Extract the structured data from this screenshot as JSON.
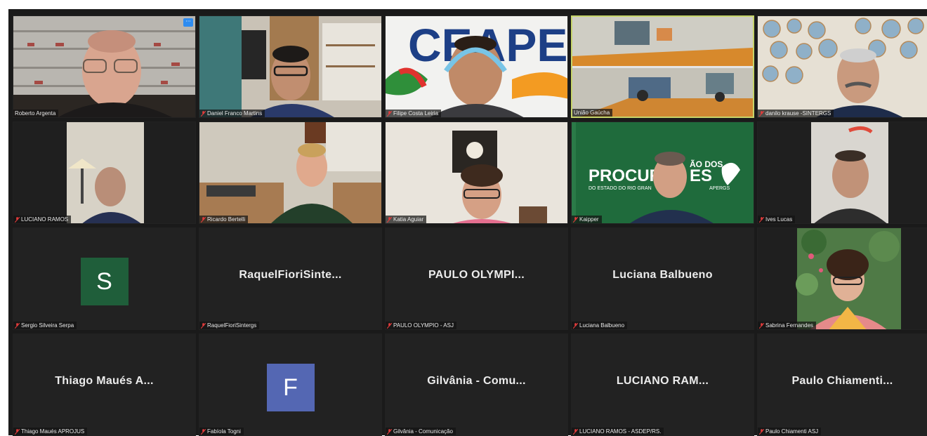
{
  "colors": {
    "active_speaker_border": "#c6d46a",
    "avatar_s": "#1f5e3a",
    "avatar_f": "#5467b3",
    "tile_bg": "#222222",
    "frame_bg": "#1a1a1a"
  },
  "tiles": [
    {
      "name": "Roberto Argenta",
      "type": "video",
      "muted": false
    },
    {
      "name": "Daniel Franco Martins",
      "type": "video",
      "muted": true
    },
    {
      "name": "Filipe Costa Leiria",
      "type": "video",
      "muted": true,
      "bg_text": "CEAPE"
    },
    {
      "name": "União Gaúcha",
      "type": "video",
      "muted": false,
      "active": true
    },
    {
      "name": "danilo krause -SINTERGS",
      "type": "video",
      "muted": true
    },
    {
      "name": "LUCIANO RAMOS",
      "type": "video",
      "muted": true
    },
    {
      "name": "Ricardo Bertelli",
      "type": "video",
      "muted": true
    },
    {
      "name": "Katia Aguiar",
      "type": "video",
      "muted": true
    },
    {
      "name": "Kaipper",
      "type": "video",
      "muted": true,
      "bg_text": "PROCUR",
      "bg_text2": "ES",
      "bg_sub": "DO ESTADO DO RIO GRAN",
      "bg_sub2": "APERGS",
      "bg_small": "ÃO DOS"
    },
    {
      "name": "Ives Lucas",
      "type": "video",
      "muted": true
    },
    {
      "name": "Sergio Silveira Serpa",
      "type": "avatar",
      "muted": true,
      "initial": "S"
    },
    {
      "name": "RaquelFioriSintergs",
      "type": "text",
      "muted": true,
      "display": "RaquelFioriSinte..."
    },
    {
      "name": "PAULO OLYMPIO - ASJ",
      "type": "text",
      "muted": true,
      "display": "PAULO  OLYMPI..."
    },
    {
      "name": "Luciana Balbueno",
      "type": "text",
      "muted": true,
      "display": "Luciana Balbueno"
    },
    {
      "name": "Sabrina Fernandes",
      "type": "video",
      "muted": true
    },
    {
      "name": "Thiago Maués APROJUS",
      "type": "text",
      "muted": true,
      "display": "Thiago Maués A..."
    },
    {
      "name": "Fabíola Togni",
      "type": "avatar",
      "muted": true,
      "initial": "F"
    },
    {
      "name": "Gilvânia - Comunicação",
      "type": "text",
      "muted": true,
      "display": "Gilvânia  -  Comu..."
    },
    {
      "name": "LUCIANO RAMOS - ASDEP/RS.",
      "type": "text",
      "muted": true,
      "display": "LUCIANO  RAM..."
    },
    {
      "name": "Paulo Chiamenti ASJ",
      "type": "text",
      "muted": true,
      "display": "Paulo  Chiamenti..."
    }
  ],
  "more_button": "···"
}
